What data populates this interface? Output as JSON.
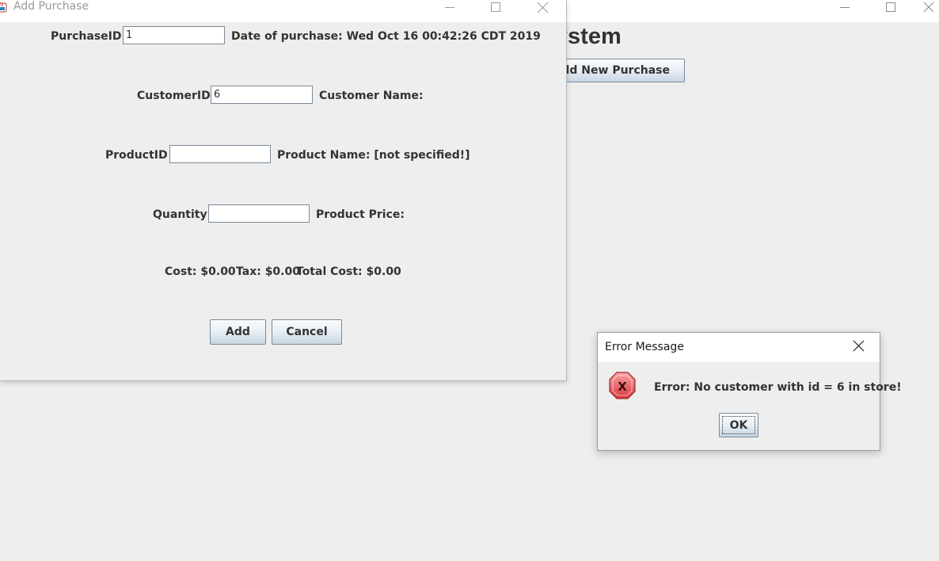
{
  "main_window": {
    "heading": "ent System",
    "add_new_purchase_label": "Add New Purchase"
  },
  "add_purchase_dialog": {
    "title": "Add Purchase",
    "purchase_id_label": "PurchaseID",
    "purchase_id_value": "1",
    "date_label": "Date of purchase: Wed Oct 16 00:42:26 CDT 2019",
    "customer_id_label": "CustomerID",
    "customer_id_value": "6",
    "customer_name_label": "Customer Name:",
    "product_id_label": "ProductID",
    "product_id_value": "",
    "product_name_label": "Product Name: [not specified!]",
    "quantity_label": "Quantity",
    "quantity_value": "",
    "product_price_label": "Product Price:",
    "cost_label": "Cost: $0.00",
    "tax_label": "Tax: $0.00",
    "total_cost_label": "Total Cost: $0.00",
    "add_label": "Add",
    "cancel_label": "Cancel"
  },
  "error_dialog": {
    "title": "Error Message",
    "message": "Error: No customer with id = 6 in store!",
    "ok_label": "OK",
    "icon": "error-x-icon"
  },
  "colors": {
    "background": "#eeeeee",
    "titlebar": "#ffffff",
    "text": "#333333",
    "error_icon": "#e8555a"
  }
}
